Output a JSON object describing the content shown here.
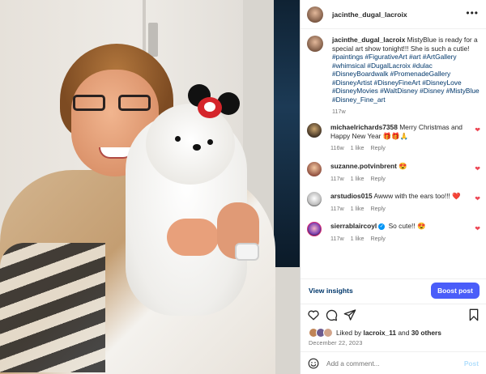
{
  "post": {
    "username": "jacinthe_dugal_lacroix",
    "more_icon": "more-horizontal-icon",
    "caption_username": "jacinthe_dugal_lacroix",
    "caption_text": "MistyBlue is ready for a special art show tonight!!! She is such a cutie!",
    "caption_tags": "#paintings #FigurativeArt #art #ArtGallery #whimsical #DugalLacroix #dulac #DisneyBoardwalk #PromenadeGallery #DisneyArtist #DisneyFineArt #DisneyLove #DisneyMovies #WaltDisney #Disney #MistyBlue #Disney_Fine_art",
    "caption_age": "117w"
  },
  "comments": [
    {
      "username": "michaelrichards7358",
      "text": "Merry Christmas and Happy New Year 🎁🎁🙏",
      "age": "116w",
      "likes": "1 like",
      "reply": "Reply",
      "verified": false
    },
    {
      "username": "suzanne.potvinbrent",
      "text": "😍",
      "age": "117w",
      "likes": "1 like",
      "reply": "Reply",
      "verified": false
    },
    {
      "username": "arstudios015",
      "text": "Awww with the ears too!!! ❤️",
      "age": "117w",
      "likes": "1 like",
      "reply": "Reply",
      "verified": false
    },
    {
      "username": "sierrablaircoyl",
      "text": "So cute!! 😍",
      "age": "117w",
      "likes": "1 like",
      "reply": "Reply",
      "verified": true
    }
  ],
  "insights": {
    "view_insights": "View insights",
    "boost_post": "Boost post"
  },
  "likes": {
    "prefix": "Liked by",
    "user": "lacroix_11",
    "joiner": "and",
    "others": "30 others"
  },
  "date": "December 22, 2023",
  "add_comment": {
    "placeholder": "Add a comment...",
    "post_label": "Post"
  },
  "colors": {
    "accent": "#4a5df9",
    "link": "#00376b",
    "heart": "#ed4956",
    "muted": "#737373"
  }
}
